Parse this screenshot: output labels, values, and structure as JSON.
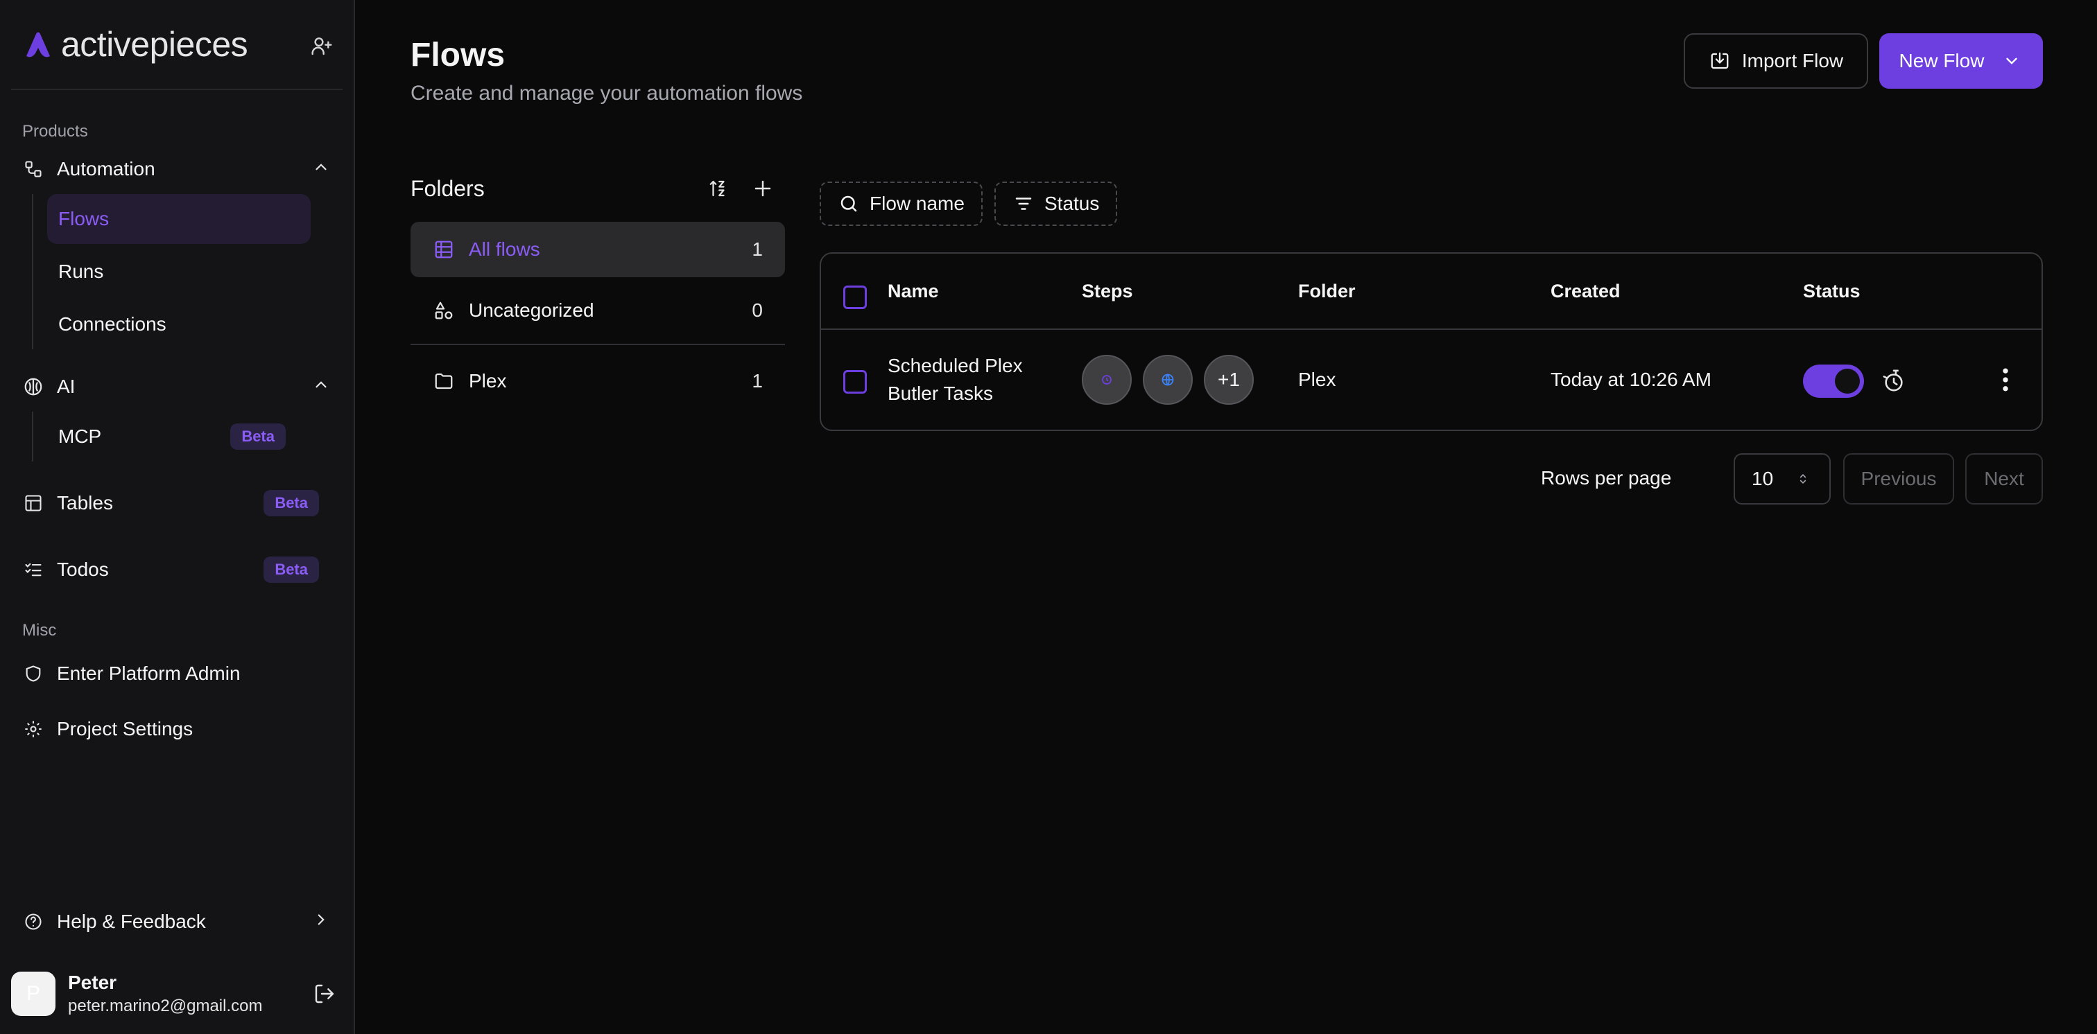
{
  "sidebar": {
    "logo_text": "activepieces",
    "products_label": "Products",
    "automation_label": "Automation",
    "automation_items": [
      {
        "label": "Flows"
      },
      {
        "label": "Runs"
      },
      {
        "label": "Connections"
      }
    ],
    "ai_label": "AI",
    "mcp_label": "MCP",
    "tables_label": "Tables",
    "todos_label": "Todos",
    "beta_label": "Beta",
    "misc_label": "Misc",
    "platform_admin_label": "Enter Platform Admin",
    "project_settings_label": "Project Settings",
    "help_label": "Help & Feedback",
    "user": {
      "initial": "P",
      "name": "Peter",
      "email": "peter.marino2@gmail.com"
    }
  },
  "header": {
    "title": "Flows",
    "subtitle": "Create and manage your automation flows",
    "import_label": "Import Flow",
    "new_label": "New Flow"
  },
  "folders": {
    "title": "Folders",
    "items": [
      {
        "label": "All flows",
        "count": "1"
      },
      {
        "label": "Uncategorized",
        "count": "0"
      },
      {
        "label": "Plex",
        "count": "1"
      }
    ]
  },
  "filters": {
    "name_label": "Flow name",
    "status_label": "Status"
  },
  "table": {
    "columns": [
      "Name",
      "Steps",
      "Folder",
      "Created",
      "Status"
    ],
    "rows": [
      {
        "name_line1": "Scheduled Plex",
        "name_line2": "Butler Tasks",
        "steps_more": "+1",
        "folder": "Plex",
        "created": "Today at 10:26 AM",
        "enabled": true
      }
    ]
  },
  "pagination": {
    "rows_per_page_label": "Rows per page",
    "rows_per_page_value": "10",
    "previous_label": "Previous",
    "next_label": "Next"
  },
  "colors": {
    "accent": "#6d3fe0",
    "accent_text": "#8b5cf6",
    "background": "#0a0a0a",
    "sidebar_bg": "#141416"
  }
}
